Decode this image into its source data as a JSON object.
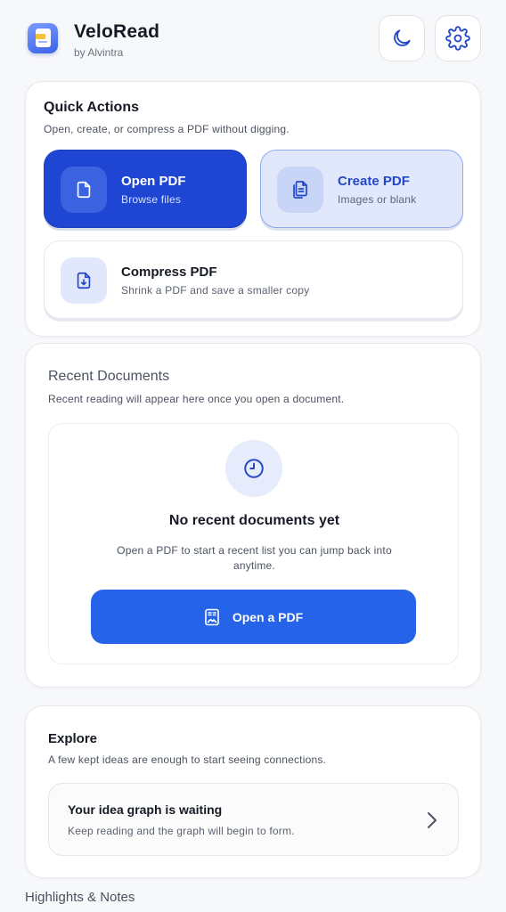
{
  "header": {
    "app_name": "VeloRead",
    "byline": "by Alvintra",
    "dark_mode_icon": "moon-icon",
    "settings_icon": "gear-icon"
  },
  "quick_actions": {
    "title": "Quick Actions",
    "description": "Open, create, or compress a PDF without digging.",
    "tiles": [
      {
        "title": "Open PDF",
        "subtitle": "Browse files",
        "icon": "file-icon"
      },
      {
        "title": "Create PDF",
        "subtitle": "Images or blank",
        "icon": "copy-files-icon"
      },
      {
        "title": "Compress PDF",
        "subtitle": "Shrink a PDF and save a smaller copy",
        "icon": "file-download-icon"
      }
    ]
  },
  "recent": {
    "title": "Recent Documents",
    "description": "Recent reading will appear here once you open a document.",
    "empty_title": "No recent documents yet",
    "empty_text": "Open a PDF to start a recent list you can jump back into anytime.",
    "button_label": "Open a PDF",
    "button_icon": "document-image-icon",
    "empty_icon": "clock-icon"
  },
  "explore": {
    "title": "Explore",
    "description": "A few kept ideas are enough to start seeing connections.",
    "row_title": "Your idea graph is waiting",
    "row_subtitle": "Keep reading and the graph will begin to form.",
    "row_icon": "chevron-right-icon"
  },
  "highlights": {
    "title": "Highlights & Notes"
  },
  "colors": {
    "primary": "#1e46d2",
    "button_blue": "#2563e8",
    "accent_light": "#e1e8fb",
    "background": "#f7f8fa"
  }
}
